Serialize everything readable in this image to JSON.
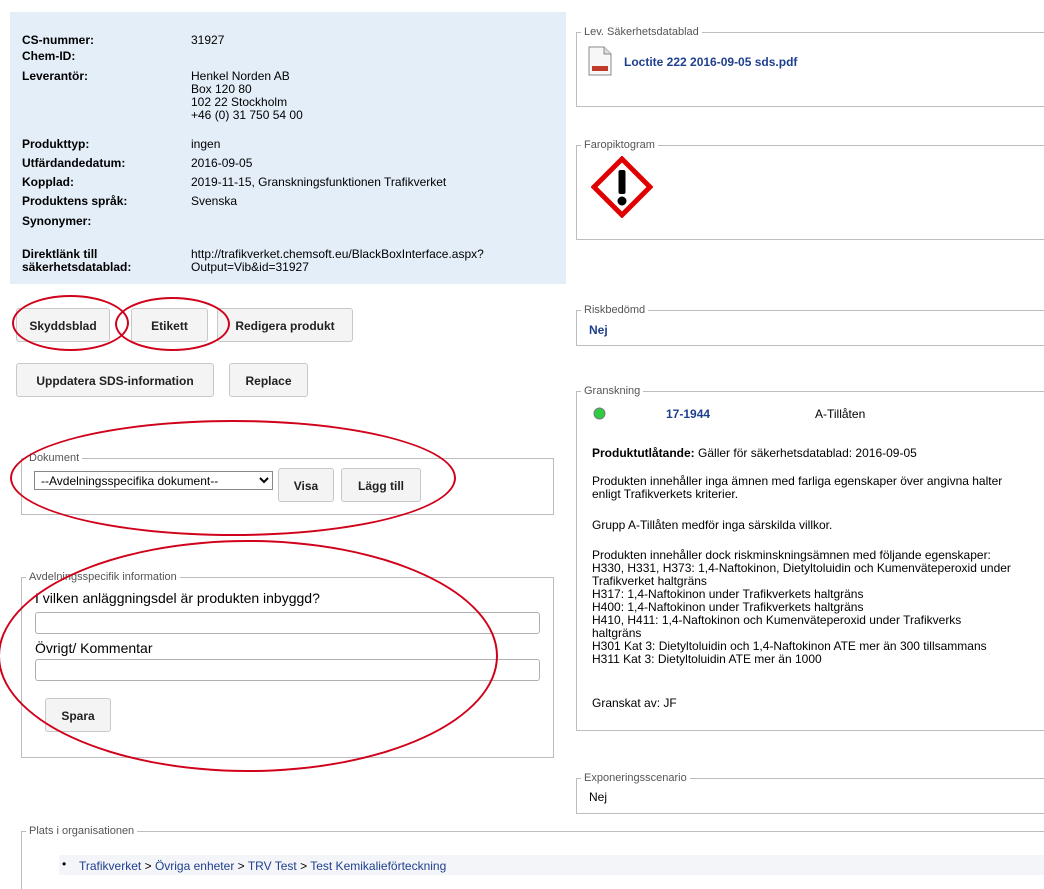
{
  "info": {
    "cs_label": "CS-nummer:",
    "cs_value": "31927",
    "chem_label": "Chem-ID:",
    "supplier_label": "Leverantör:",
    "supplier_value": "Henkel Norden AB\nBox 120 80\n102 22 Stockholm\n+46 (0) 31 750 54 00",
    "type_label": "Produkttyp:",
    "type_value": "ingen",
    "issue_label": "Utfärdandedatum:",
    "issue_value": "2016-09-05",
    "linked_label": "Kopplad:",
    "linked_value": "2019-11-15, Granskningsfunktionen Trafikverket",
    "lang_label": "Produktens språk:",
    "lang_value": "Svenska",
    "syn_label": "Synonymer:",
    "direct_label": "Direktlänk till\nsäkerhetsdatablad:",
    "direct_value": "http://trafikverket.chemsoft.eu/BlackBoxInterface.aspx?\nOutput=Vib&id=31927"
  },
  "buttons": {
    "skyddsblad": "Skyddsblad",
    "etikett": "Etikett",
    "redigera": "Redigera produkt",
    "uppdatera": "Uppdatera SDS-information",
    "replace": "Replace"
  },
  "dokument": {
    "legend": "Dokument",
    "select_value": "--Avdelningsspecifika dokument--",
    "visa": "Visa",
    "lagg_till": "Lägg till"
  },
  "avd": {
    "legend": "Avdelningsspecifik information",
    "q1": "I vilken anläggningsdel är produkten inbyggd?",
    "q2": "Övrigt/ Kommentar",
    "spara": "Spara"
  },
  "plats": {
    "legend": "Plats i organisationen",
    "crumbs": [
      "Trafikverket",
      "Övriga enheter",
      "TRV Test",
      "Test Kemikalieförteckning"
    ],
    "sep": ">"
  },
  "sds": {
    "legend": "Lev. Säkerhetsdatablad",
    "file": "Loctite 222 2016-09-05 sds.pdf"
  },
  "faro": {
    "legend": "Faropiktogram"
  },
  "risk": {
    "legend": "Riskbedömd",
    "value": "Nej"
  },
  "gransk": {
    "legend": "Granskning",
    "status_color": "#2ecc40",
    "id": "17-1944",
    "status": "A-Tillåten",
    "utl_label": "Produktutlåtande:",
    "utl_text": "Gäller för säkerhetsdatablad: 2016-09-05",
    "p1": "Produkten innehåller inga ämnen med farliga egenskaper över angivna halter\nenligt Trafikverkets kriterier.",
    "p2": "Grupp A-Tillåten medför inga särskilda villkor.",
    "p3": "Produkten innehåller dock riskminskningsämnen med följande egenskaper:\nH330, H331, H373: 1,4-Naftokinon, Dietyltoluidin och Kumenväteperoxid under\nTrafikverket haltgräns\nH317: 1,4-Naftokinon under Trafikverkets haltgräns\nH400: 1,4-Naftokinon under Trafikverkets haltgräns\nH410, H411: 1,4-Naftokinon och Kumenväteperoxid under Trafikverks\nhaltgräns\nH301 Kat 3: Dietyltoluidin och 1,4-Naftokinon ATE mer än 300 tillsammans\nH311 Kat 3: Dietyltoluidin ATE mer än 1000",
    "granskat": "Granskat av: JF"
  },
  "expo": {
    "legend": "Exponeringsscenario",
    "value": "Nej"
  },
  "colors": {
    "annotation": "#d0021b",
    "panel": "#e3eef8",
    "link": "#1f3f8f"
  },
  "icons": [
    "pdf-file-icon",
    "ghs-exclamation-pictogram",
    "status-dot-icon",
    "bullet-icon"
  ]
}
